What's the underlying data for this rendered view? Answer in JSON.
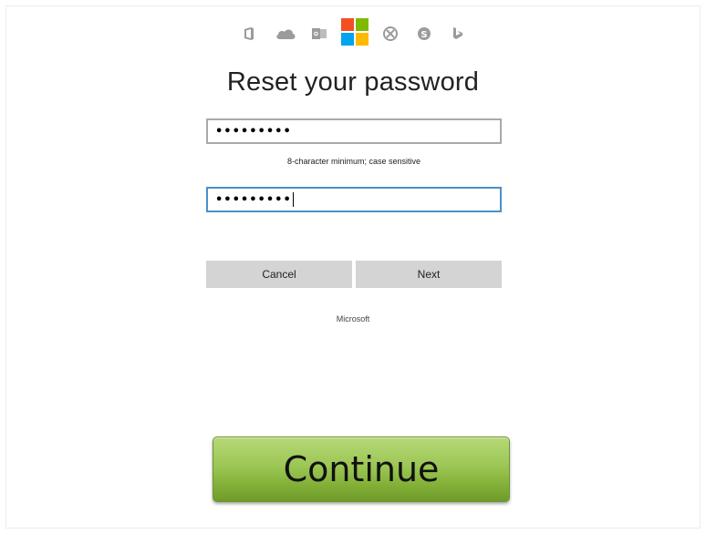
{
  "header": {
    "icons": [
      "office-icon",
      "onedrive-icon",
      "outlook-icon",
      "microsoft-logo-icon",
      "xbox-icon",
      "skype-icon",
      "bing-icon"
    ]
  },
  "form": {
    "title": "Reset your password",
    "new_password_masked": "•••••••••",
    "hint": "8-character minimum; case sensitive",
    "confirm_password_masked": "•••••••••",
    "cancel_label": "Cancel",
    "next_label": "Next"
  },
  "footer": {
    "brand": "Microsoft"
  },
  "cta": {
    "continue_label": "Continue"
  },
  "colors": {
    "microsoft_red": "#f25022",
    "microsoft_green": "#7fba00",
    "microsoft_blue": "#00a4ef",
    "microsoft_yellow": "#ffb900",
    "focus_border": "#4a8fcb",
    "continue_green": "#8ab842"
  }
}
